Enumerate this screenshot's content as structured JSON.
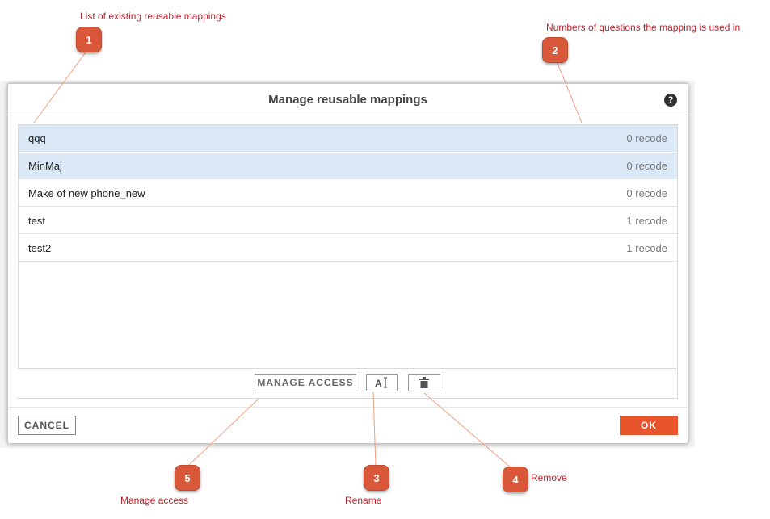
{
  "annotations": {
    "a1": {
      "number": "1",
      "text": "List of existing reusable mappings"
    },
    "a2": {
      "number": "2",
      "text": "Numbers of questions the mapping is used in"
    },
    "a3": {
      "number": "3",
      "text": "Rename"
    },
    "a4": {
      "number": "4",
      "text": "Remove"
    },
    "a5": {
      "number": "5",
      "text": "Manage access"
    }
  },
  "dialog": {
    "title": "Manage reusable mappings",
    "help_glyph": "?",
    "mappings": [
      {
        "name": "qqq",
        "count": "0 recode",
        "selected": true
      },
      {
        "name": "MinMaj",
        "count": "0 recode",
        "selected": true
      },
      {
        "name": "Make of new phone_new",
        "count": "0 recode",
        "selected": false
      },
      {
        "name": "test",
        "count": "1 recode",
        "selected": false
      },
      {
        "name": "test2",
        "count": "1 recode",
        "selected": false
      }
    ],
    "toolbar": {
      "manage_access_label": "MANAGE ACCESS",
      "rename_icon": "text-cursor-icon",
      "delete_icon": "trash-icon"
    },
    "cancel_label": "CANCEL",
    "ok_label": "OK"
  },
  "colors": {
    "badge": "#d9583a",
    "annotation_text": "#c0202a",
    "selected_row": "#dbe9f7",
    "ok_button": "#e8552a"
  }
}
